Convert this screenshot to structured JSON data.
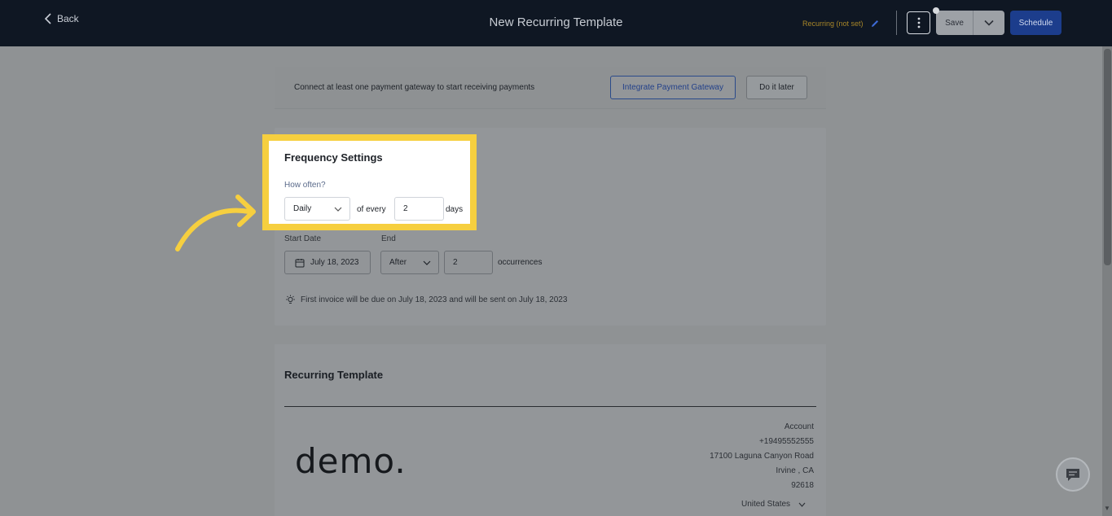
{
  "header": {
    "back_label": "Back",
    "title": "New Recurring Template",
    "recurring_status": "Recurring (not set)",
    "save_label": "Save",
    "schedule_label": "Schedule"
  },
  "gateway": {
    "message": "Connect at least one payment gateway to start receiving payments",
    "integrate_label": "Integrate Payment Gateway",
    "later_label": "Do it later"
  },
  "frequency": {
    "title": "Frequency Settings",
    "how_often_label": "How often?",
    "period_value": "Daily",
    "of_every_label": "of every",
    "interval_value": "2",
    "unit_label": "days",
    "start_date_label": "Start Date",
    "start_date_value": "July 18, 2023",
    "end_label": "End",
    "end_value": "After",
    "occurrences_value": "2",
    "occurrences_label": "occurrences",
    "info_text": "First invoice will be due on July 18, 2023 and will be sent on July 18, 2023"
  },
  "template": {
    "title": "Recurring Template",
    "logo_text": "demo.",
    "address": {
      "name": "Account",
      "phone": "+19495552555",
      "street": "17100 Laguna Canyon Road",
      "city_state": "Irvine , CA",
      "zip": "92618",
      "country": "United States"
    }
  },
  "colors": {
    "highlight": "#f6cf3f",
    "primary_button": "#1c3d8c",
    "topbar": "#0f1723",
    "overlay_bg": "#8f9294"
  }
}
